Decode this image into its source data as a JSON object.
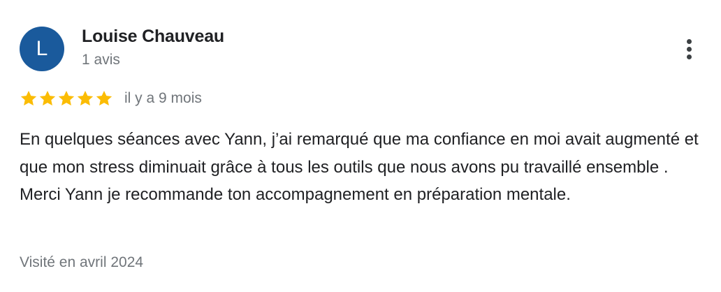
{
  "review": {
    "author": {
      "initial": "L",
      "name": "Louise Chauveau",
      "review_count": "1 avis",
      "avatar_color": "#1a5a9c"
    },
    "rating": {
      "stars": 5,
      "max_stars": 5,
      "star_color": "#fbbc04",
      "star_icon": "star-icon"
    },
    "relative_date": "il y a 9 mois",
    "text": "En quelques séances avec Yann, j’ai remarqué que ma confiance en moi avait augmenté et que mon stress diminuait grâce à tous les outils que nous avons pu travaillé ensemble . Merci Yann je recommande ton accompagnement en préparation mentale.",
    "visit": "Visité en avril 2024",
    "menu_icon": "more-vert-icon"
  }
}
